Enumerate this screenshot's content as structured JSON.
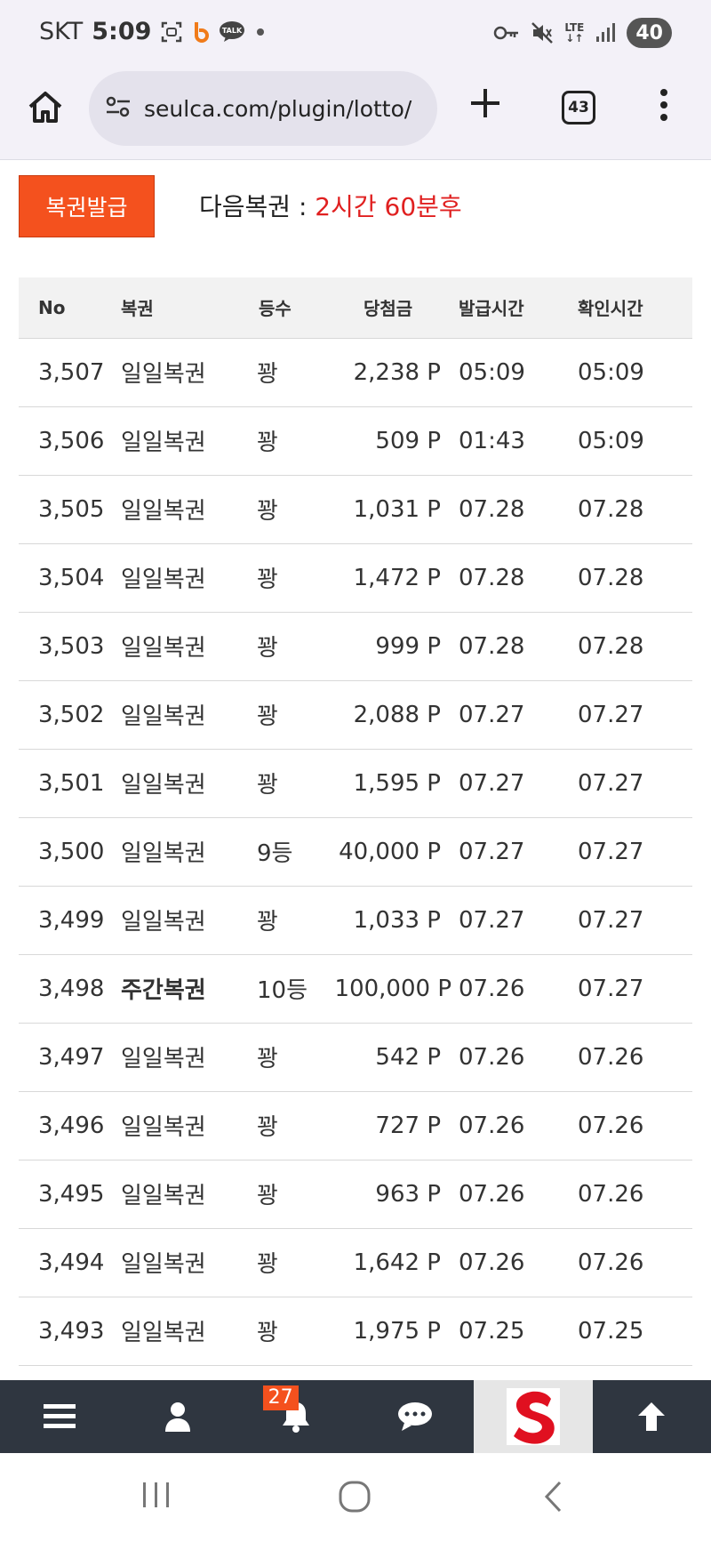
{
  "status_bar": {
    "carrier": "SKT",
    "time": "5:09",
    "battery": "40",
    "network": "LTE"
  },
  "browser": {
    "url": "seulca.com/plugin/lotto/",
    "tab_count": "43"
  },
  "issue": {
    "button_label": "복권발급",
    "next_label": "다음복권 : ",
    "next_value": "2시간 60분후"
  },
  "table": {
    "headers": {
      "no": "No",
      "type": "복권",
      "rank": "등수",
      "prize": "당첨금",
      "issued": "발급시간",
      "checked": "확인시간"
    },
    "rows": [
      {
        "no": "3,507",
        "type": "일일복권",
        "rank": "꽝",
        "prize": "2,238 P",
        "issued": "05:09",
        "checked": "05:09"
      },
      {
        "no": "3,506",
        "type": "일일복권",
        "rank": "꽝",
        "prize": "509 P",
        "issued": "01:43",
        "checked": "05:09"
      },
      {
        "no": "3,505",
        "type": "일일복권",
        "rank": "꽝",
        "prize": "1,031 P",
        "issued": "07.28",
        "checked": "07.28"
      },
      {
        "no": "3,504",
        "type": "일일복권",
        "rank": "꽝",
        "prize": "1,472 P",
        "issued": "07.28",
        "checked": "07.28"
      },
      {
        "no": "3,503",
        "type": "일일복권",
        "rank": "꽝",
        "prize": "999 P",
        "issued": "07.28",
        "checked": "07.28"
      },
      {
        "no": "3,502",
        "type": "일일복권",
        "rank": "꽝",
        "prize": "2,088 P",
        "issued": "07.27",
        "checked": "07.27"
      },
      {
        "no": "3,501",
        "type": "일일복권",
        "rank": "꽝",
        "prize": "1,595 P",
        "issued": "07.27",
        "checked": "07.27"
      },
      {
        "no": "3,500",
        "type": "일일복권",
        "rank": "9등",
        "prize": "40,000 P",
        "issued": "07.27",
        "checked": "07.27"
      },
      {
        "no": "3,499",
        "type": "일일복권",
        "rank": "꽝",
        "prize": "1,033 P",
        "issued": "07.27",
        "checked": "07.27"
      },
      {
        "no": "3,498",
        "type": "주간복권",
        "rank": "10등",
        "prize": "100,000 P",
        "issued": "07.26",
        "checked": "07.27"
      },
      {
        "no": "3,497",
        "type": "일일복권",
        "rank": "꽝",
        "prize": "542 P",
        "issued": "07.26",
        "checked": "07.26"
      },
      {
        "no": "3,496",
        "type": "일일복권",
        "rank": "꽝",
        "prize": "727 P",
        "issued": "07.26",
        "checked": "07.26"
      },
      {
        "no": "3,495",
        "type": "일일복권",
        "rank": "꽝",
        "prize": "963 P",
        "issued": "07.26",
        "checked": "07.26"
      },
      {
        "no": "3,494",
        "type": "일일복권",
        "rank": "꽝",
        "prize": "1,642 P",
        "issued": "07.26",
        "checked": "07.26"
      },
      {
        "no": "3,493",
        "type": "일일복권",
        "rank": "꽝",
        "prize": "1,975 P",
        "issued": "07.25",
        "checked": "07.25"
      }
    ]
  },
  "site_nav": {
    "notification_count": "27",
    "items": [
      "menu-icon",
      "user-icon",
      "bell-icon",
      "chat-icon",
      "site-logo",
      "arrow-up-icon"
    ]
  },
  "colors": {
    "accent": "#f4511e",
    "countdown": "#e02020",
    "nav_background": "#2f3640"
  }
}
